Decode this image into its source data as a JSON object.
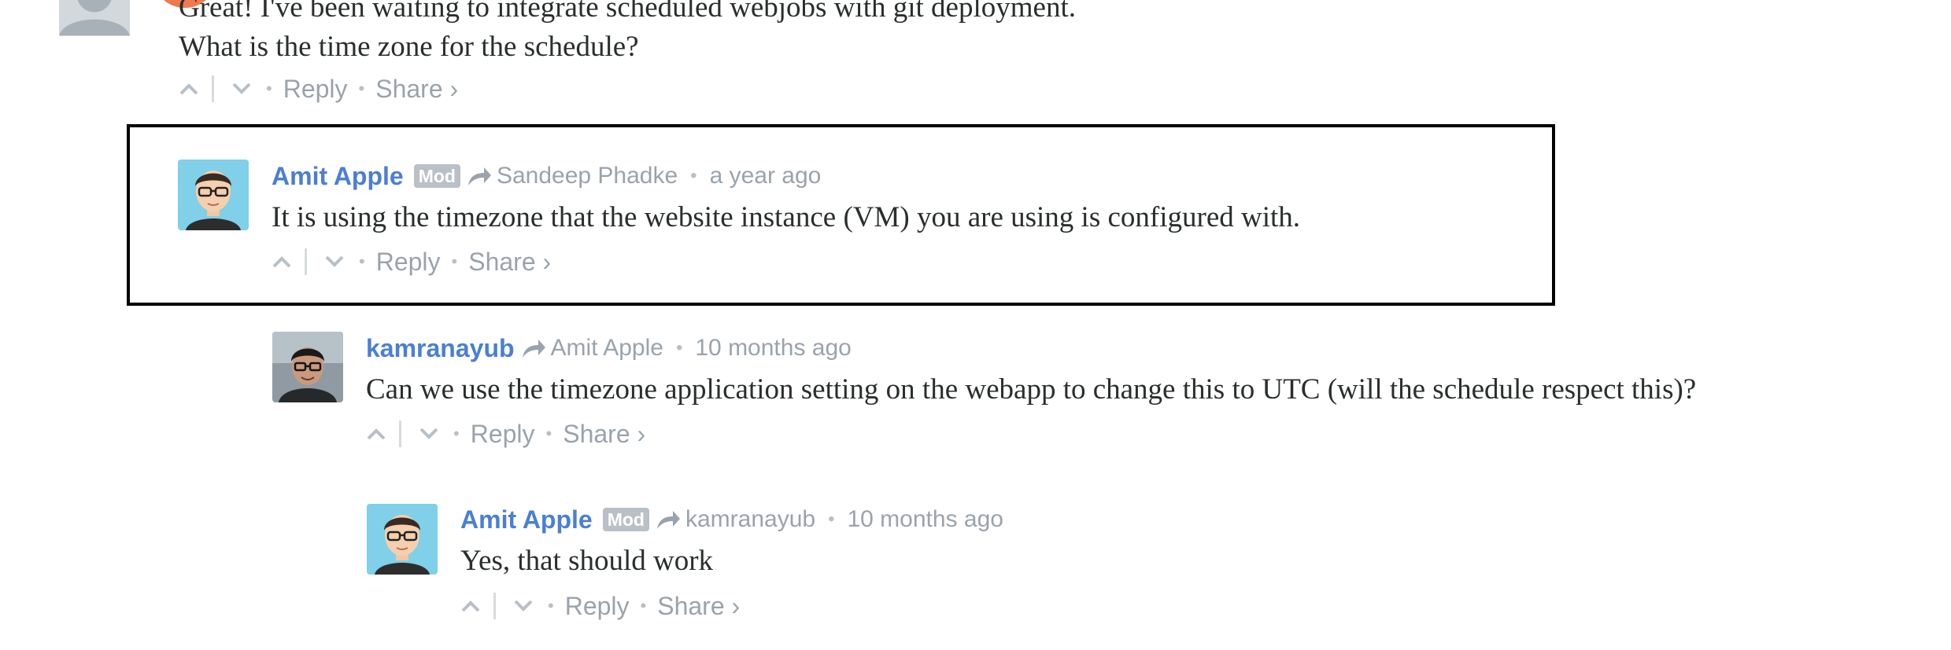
{
  "top_comment": {
    "line1": "Great! I've been waiting to integrate scheduled webjobs with git deployment.",
    "line2": "What is the time zone for the schedule?",
    "actions": {
      "reply": "Reply",
      "share": "Share ›"
    }
  },
  "comments": [
    {
      "author": "Amit Apple",
      "badge": "Mod",
      "reply_to": "Sandeep Phadke",
      "time": "a year ago",
      "text": "It is using the timezone that the website instance (VM) you are using is configured with.",
      "actions": {
        "reply": "Reply",
        "share": "Share ›"
      },
      "avatar": "cartoon-man-glasses-avatar",
      "highlighted": true
    },
    {
      "author": "kamranayub",
      "reply_to": "Amit Apple",
      "time": "10 months ago",
      "text": "Can we use the timezone application setting on the webapp to change this to UTC (will the schedule respect this)?",
      "actions": {
        "reply": "Reply",
        "share": "Share ›"
      },
      "avatar": "photo-man-glasses-avatar"
    },
    {
      "author": "Amit Apple",
      "badge": "Mod",
      "reply_to": "kamranayub",
      "time": "10 months ago",
      "text": "Yes, that should work",
      "actions": {
        "reply": "Reply",
        "share": "Share ›"
      },
      "avatar": "cartoon-man-glasses-avatar"
    }
  ],
  "colors": {
    "author": "#4a7fd4",
    "meta": "#9aa3ab",
    "body": "#2a2e2e",
    "badge_bg": "#b9c0c6",
    "highlight_border": "#000000"
  }
}
